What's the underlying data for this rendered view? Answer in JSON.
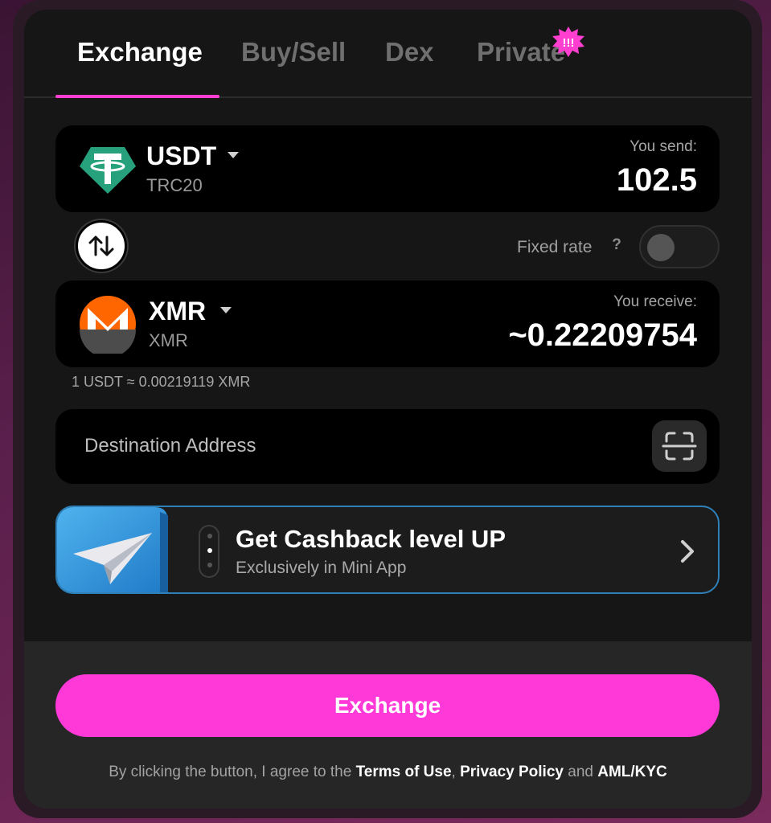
{
  "tabs": [
    {
      "label": "Exchange",
      "active": true
    },
    {
      "label": "Buy/Sell",
      "active": false
    },
    {
      "label": "Dex",
      "active": false
    },
    {
      "label": "Private",
      "active": false
    }
  ],
  "private_badge": "!!!",
  "send": {
    "coin": "USDT",
    "network": "TRC20",
    "amount_label": "You send:",
    "amount": "102.5",
    "icon": "tether-icon"
  },
  "receive": {
    "coin": "XMR",
    "network": "XMR",
    "amount_label": "You receive:",
    "amount": "~0.22209754",
    "icon": "monero-icon"
  },
  "fixed_rate": {
    "label": "Fixed rate",
    "help": "?",
    "enabled": false
  },
  "rate_line": "1 USDT ≈ 0.00219119 XMR",
  "destination": {
    "placeholder": "Destination Address",
    "value": ""
  },
  "promo": {
    "title": "Get Cashback level UP",
    "subtitle": "Exclusively in Mini App"
  },
  "exchange_button": "Exchange",
  "legal": {
    "prefix": "By clicking the button, I agree to the ",
    "terms": "Terms of Use",
    "comma": ", ",
    "privacy": "Privacy Policy",
    "and": " and ",
    "aml": "AML/KYC"
  },
  "colors": {
    "accent": "#ff38d8",
    "tether": "#26a17b",
    "monero": "#ff6600",
    "promo_border": "#2f7fb8"
  }
}
